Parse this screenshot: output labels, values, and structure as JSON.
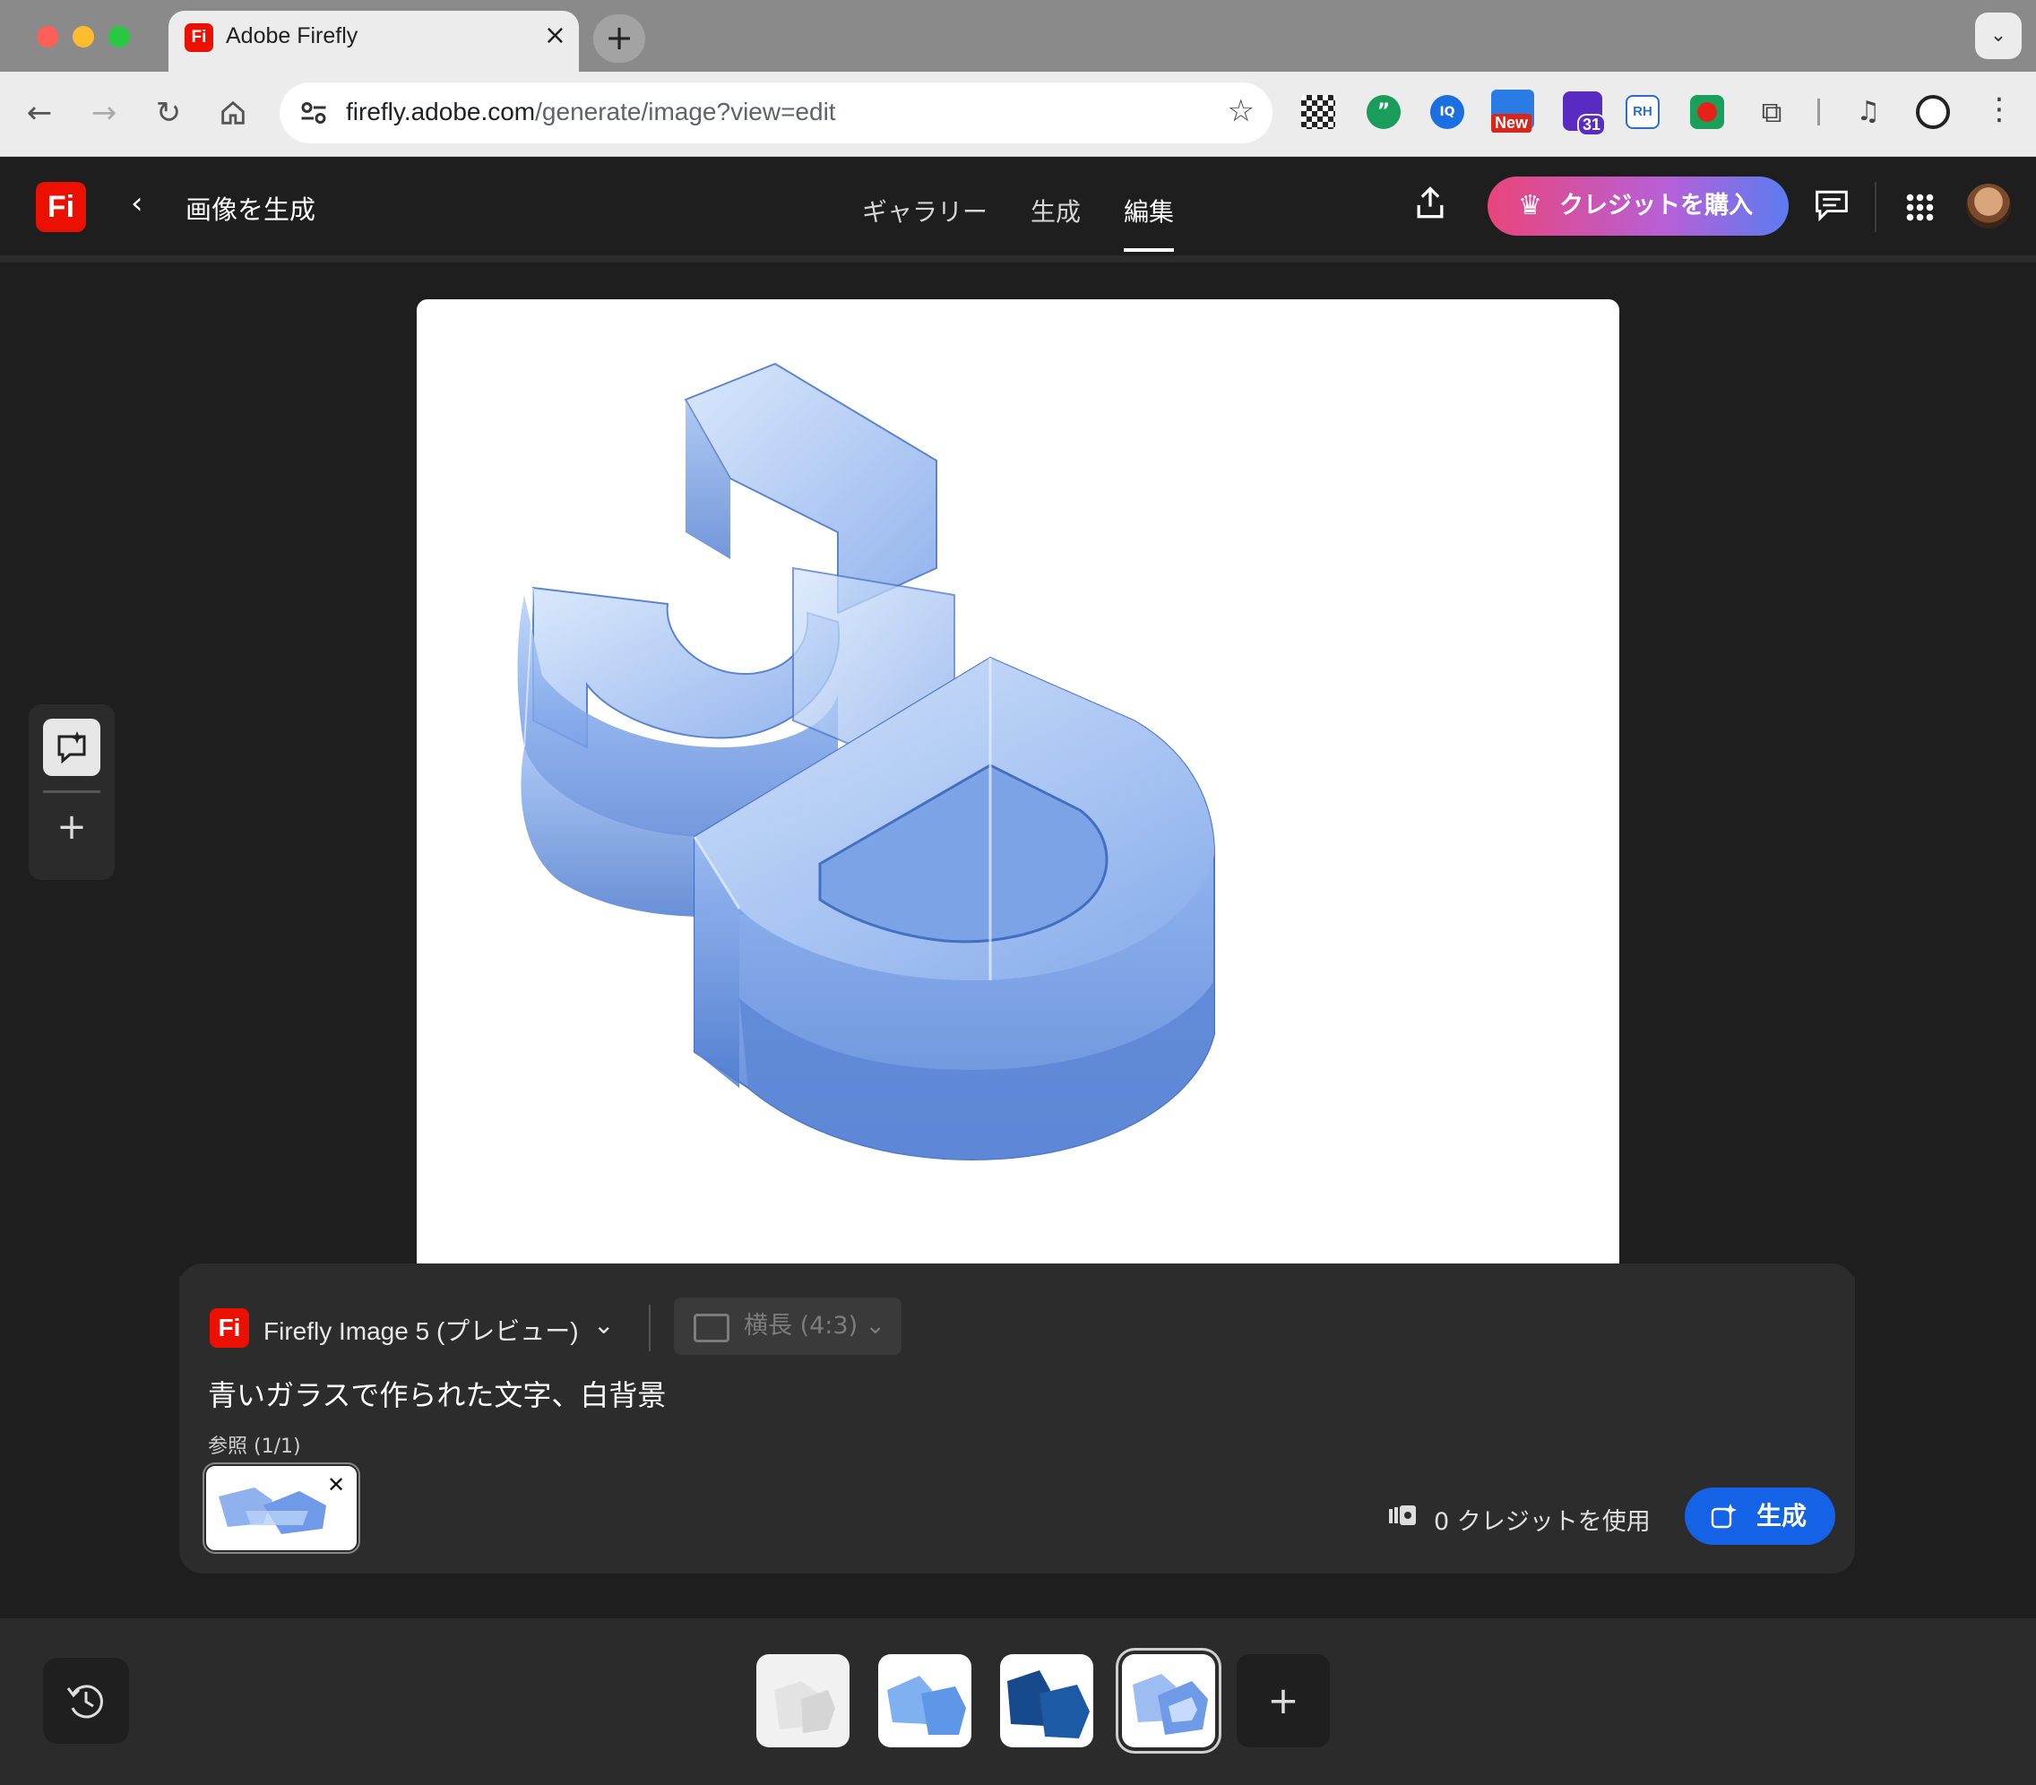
{
  "browser": {
    "tab_title": "Adobe Firefly",
    "tab_favicon": "Fi",
    "url_host": "firefly.adobe.com",
    "url_path": "/generate/image?view=edit",
    "ext_new_badge": "New",
    "ext_calendar_badge": "31",
    "ext_rh_label": "RH"
  },
  "header": {
    "logo": "Fi",
    "title": "画像を生成",
    "tabs": [
      {
        "label": "ギャラリー"
      },
      {
        "label": "生成"
      },
      {
        "label": "編集"
      }
    ],
    "active_tab": "編集",
    "buy_credits_label": "クレジットを購入"
  },
  "prompt_panel": {
    "model_logo": "Fi",
    "model_name": "Firefly Image 5 (プレビュー)",
    "aspect_label": "横長 (4:3)",
    "prompt": "青いガラスで作られた文字、白背景",
    "reference_label": "参照 (1/1)",
    "credit_usage": "0 クレジットを使用",
    "generate_label": "生成"
  },
  "filmstrip": {
    "thumbnails": [
      "glass-3d-light",
      "glass-3d-blue-side",
      "3d-dark-blue",
      "glass-3d-selected"
    ],
    "selected_index": 3
  },
  "colors": {
    "accent_blue": "#1463e6",
    "adobe_red": "#eb1000",
    "glass_blue": "#6f9ae8"
  },
  "icons": [
    "back-icon",
    "forward-icon",
    "reload-icon",
    "home-icon",
    "star-icon",
    "share-icon",
    "chat-icon",
    "apps-icon",
    "history-icon",
    "add-icon"
  ]
}
